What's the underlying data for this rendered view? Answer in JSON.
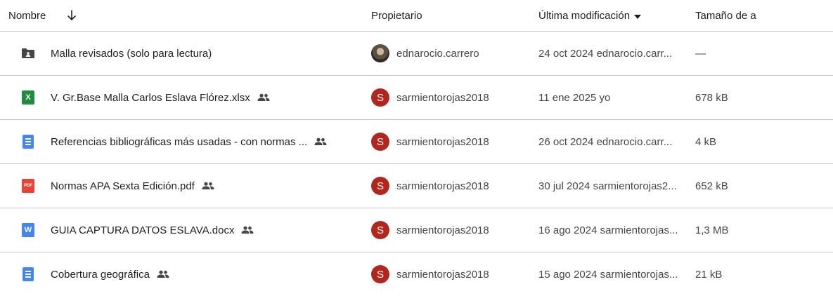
{
  "header": {
    "name_label": "Nombre",
    "owner_label": "Propietario",
    "modified_label": "Última modificación",
    "size_label": "Tamaño de a"
  },
  "files": [
    {
      "name": "Malla revisados (solo para lectura)",
      "type_icon": "shared-folder-icon",
      "shared": false,
      "owner": "ednarocio.carrero",
      "owner_avatar": "photo",
      "modified": "24 oct 2024 ednarocio.carr...",
      "size": "—"
    },
    {
      "name": "V. Gr.Base Malla Carlos Eslava Flórez.xlsx",
      "type_icon": "excel-icon",
      "icon_letter": "X",
      "shared": true,
      "owner": "sarmientorojas2018",
      "owner_initial": "S",
      "modified": "11 ene 2025 yo",
      "size": "678 kB"
    },
    {
      "name": "Referencias bibliográficas más usadas - con normas ...",
      "type_icon": "google-docs-icon",
      "shared": true,
      "owner": "sarmientorojas2018",
      "owner_initial": "S",
      "modified": "26 oct 2024 ednarocio.carr...",
      "size": "4 kB"
    },
    {
      "name": "Normas APA Sexta Edición.pdf",
      "type_icon": "pdf-icon",
      "icon_letter": "PDF",
      "shared": true,
      "owner": "sarmientorojas2018",
      "owner_initial": "S",
      "modified": "30 jul 2024 sarmientorojas2...",
      "size": "652 kB"
    },
    {
      "name": "GUIA CAPTURA DATOS ESLAVA.docx",
      "type_icon": "word-icon",
      "icon_letter": "W",
      "shared": true,
      "owner": "sarmientorojas2018",
      "owner_initial": "S",
      "modified": "16 ago 2024 sarmientorojas...",
      "size": "1,3 MB"
    },
    {
      "name": "Cobertura geográfica",
      "type_icon": "google-docs-icon",
      "shared": true,
      "owner": "sarmientorojas2018",
      "owner_initial": "S",
      "modified": "15 ago 2024 sarmientorojas...",
      "size": "21 kB"
    }
  ],
  "colors": {
    "avatar_bg": "#b3261e",
    "sheets_green": "#1e8e3e",
    "docs_blue": "#4285f4",
    "pdf_red": "#ea4335",
    "divider": "#c4c7c5"
  }
}
